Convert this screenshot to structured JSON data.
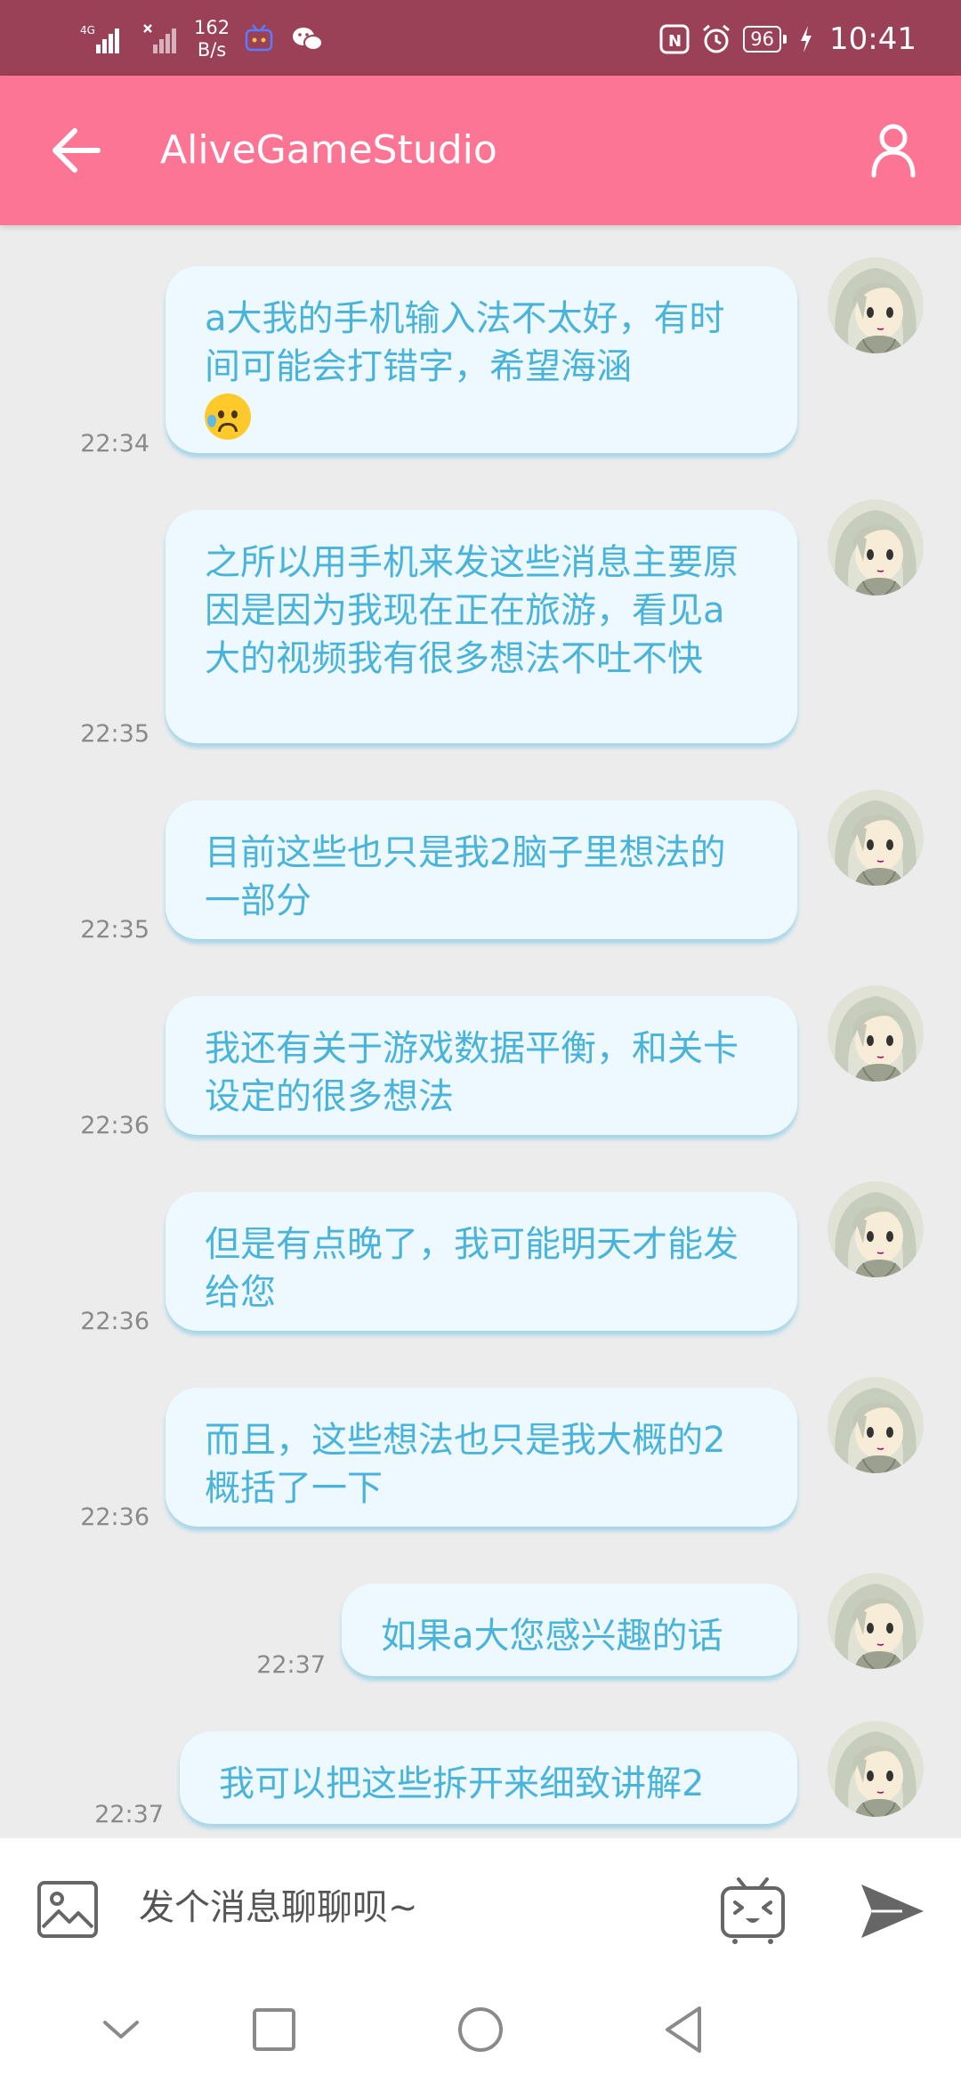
{
  "status_bar": {
    "network": "4G",
    "speed_value": "162",
    "speed_unit": "B/s",
    "nfc": "N",
    "battery": "96",
    "time": "10:41"
  },
  "header": {
    "title": "AliveGameStudio"
  },
  "messages": [
    {
      "text": "a大我的手机输入法不太好，有时间可能会打错字，希望海涵",
      "emoji": "sad-sweat-emoji",
      "time": "22:34"
    },
    {
      "text": "之所以用手机来发这些消息主要原因是因为我现在正在旅游，看见a大的视频我有很多想法不吐不快",
      "time": "22:35"
    },
    {
      "text": "目前这些也只是我2脑子里想法的一部分",
      "time": "22:35"
    },
    {
      "text": "我还有关于游戏数据平衡，和关卡设定的很多想法",
      "time": "22:36"
    },
    {
      "text": "但是有点晚了，我可能明天才能发给您",
      "time": "22:36"
    },
    {
      "text": "而且，这些想法也只是我大概的2概括了一下",
      "time": "22:36"
    },
    {
      "text": "如果a大您感兴趣的话",
      "time": "22:37"
    },
    {
      "text": "我可以把这些拆开来细致讲解2",
      "time": "22:37"
    }
  ],
  "input": {
    "placeholder": "发个消息聊聊呗~"
  },
  "colors": {
    "status_bar": "#9a4057",
    "app_bar": "#fd7594",
    "bubble_bg": "#edf9ff",
    "bubble_text": "#4ab3d9",
    "chat_bg": "#ececec"
  }
}
